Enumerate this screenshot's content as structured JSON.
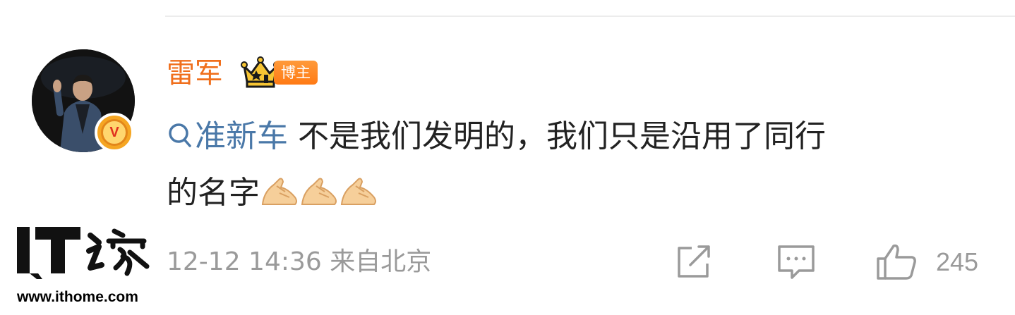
{
  "post": {
    "author": "雷军",
    "author_badge": "博主",
    "topic": "准新车",
    "text_line1": " 不是我们发明的，我们只是沿用了同行",
    "text_line2": "的名字",
    "emojis": [
      "pinched-hands",
      "pinched-hands",
      "pinched-hands"
    ],
    "timestamp": "12-12 14:36",
    "location": "来自北京",
    "like_count": "245"
  },
  "icons": {
    "verified": "verified-v-badge",
    "crown": "crown-icon",
    "topic": "search-icon",
    "repost": "share-icon",
    "comment": "comment-icon",
    "like": "thumbs-up-icon"
  },
  "colors": {
    "author": "#f06f1c",
    "topic": "#4a78a8",
    "meta": "#9a9a9a",
    "badge": "#ff7a14"
  },
  "watermark": {
    "logo_text": "IT之家",
    "url": "www.ithome.com"
  }
}
